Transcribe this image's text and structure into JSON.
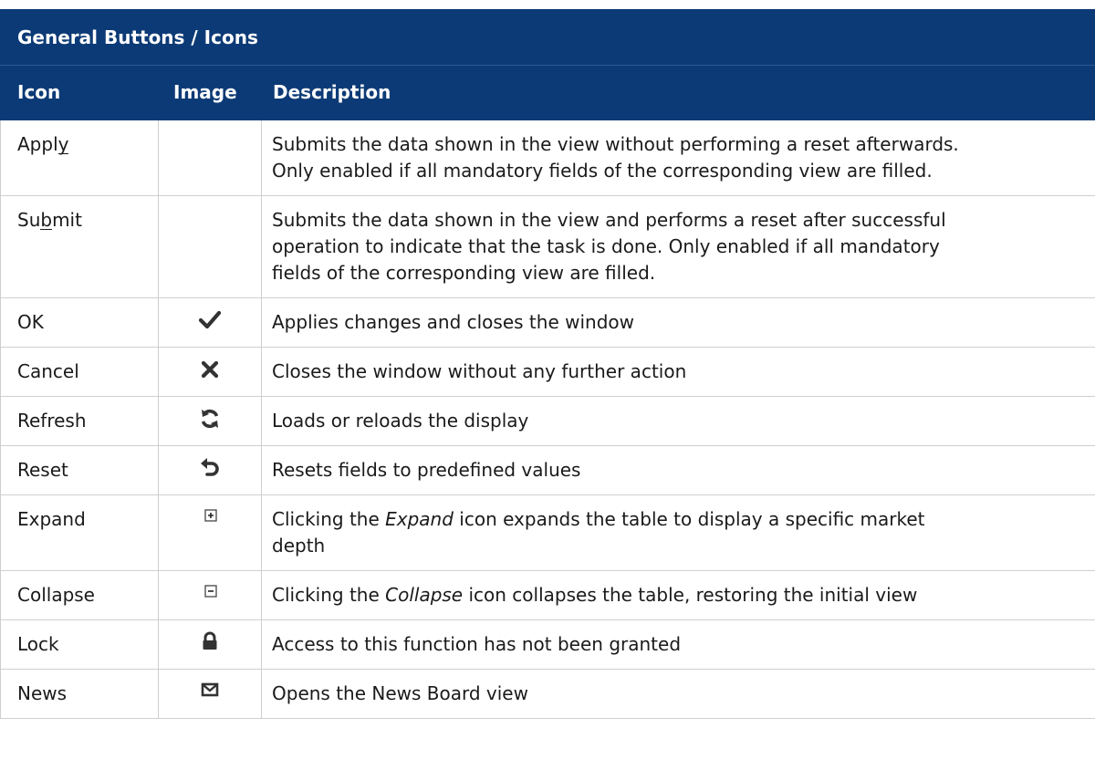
{
  "table": {
    "title": "General Buttons / Icons",
    "headers": {
      "icon": "Icon",
      "image": "Image",
      "description": "Description"
    },
    "rows": [
      {
        "name_pre": "Appl",
        "name_ul": "y",
        "name_post": "",
        "icon": "none",
        "desc_lines": [
          "Submits the data shown in the view without performing a reset afterwards.",
          "Only enabled if all mandatory fields of the corresponding view are filled."
        ]
      },
      {
        "name_pre": "Su",
        "name_ul": "b",
        "name_post": "mit",
        "icon": "none",
        "desc_lines": [
          "Submits the data shown in the view and performs a reset after successful",
          "operation to indicate that the task is done. Only enabled if all mandatory",
          "fields of the corresponding view are filled."
        ]
      },
      {
        "name": "OK",
        "icon": "checkmark-icon",
        "desc": "Applies changes and closes the window"
      },
      {
        "name": "Cancel",
        "icon": "close-icon",
        "desc": "Closes the window without any further action"
      },
      {
        "name": "Refresh",
        "icon": "refresh-icon",
        "desc": "Loads or reloads the display"
      },
      {
        "name": "Reset",
        "icon": "reset-icon",
        "desc": "Resets fields to predefined values"
      },
      {
        "name": "Expand",
        "icon": "expand-icon",
        "desc_pre": "Clicking the ",
        "desc_em": "Expand",
        "desc_post": " icon expands the table to display a specific market",
        "desc_line2": "depth"
      },
      {
        "name": "Collapse",
        "icon": "collapse-icon",
        "desc_pre": "Clicking the ",
        "desc_em": "Collapse",
        "desc_post": " icon collapses the table, restoring the initial view"
      },
      {
        "name": "Lock",
        "icon": "lock-icon",
        "desc": "Access to this function has not been granted"
      },
      {
        "name": "News",
        "icon": "envelope-icon",
        "desc": "Opens the News Board view"
      }
    ]
  }
}
